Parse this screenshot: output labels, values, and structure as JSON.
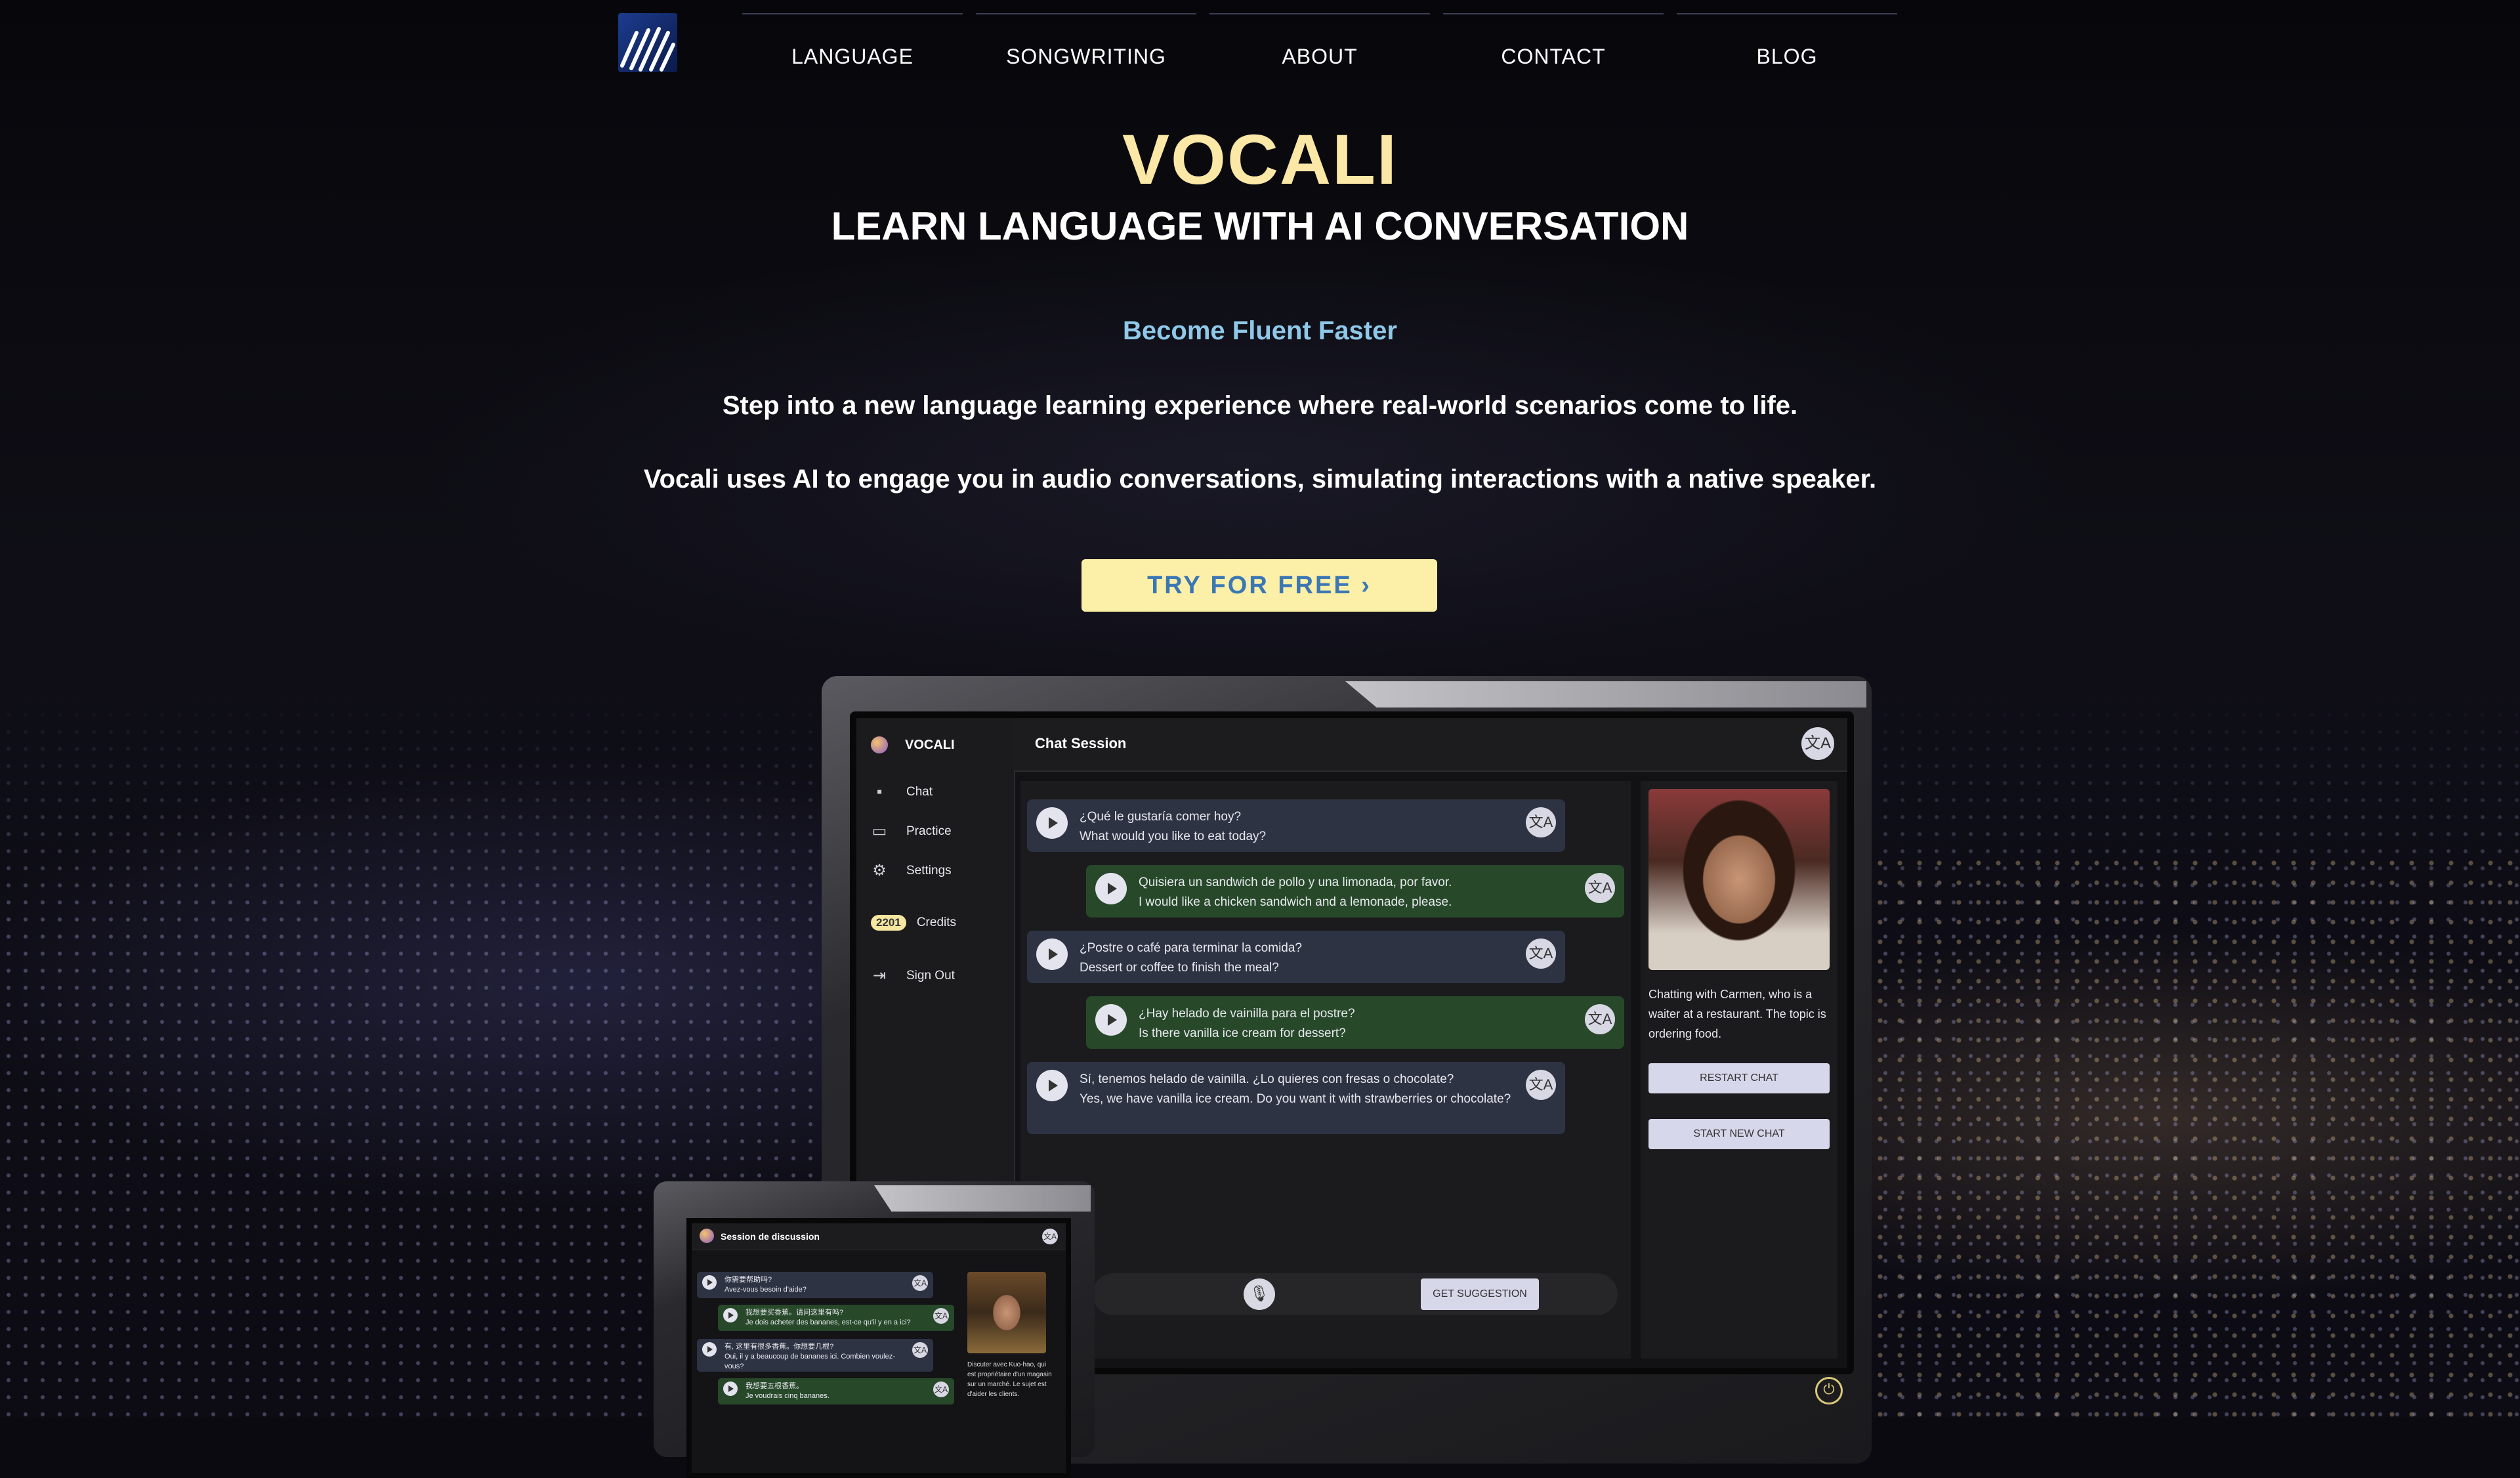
{
  "nav": {
    "items": [
      "LANGUAGE",
      "SONGWRITING",
      "ABOUT",
      "CONTACT",
      "BLOG"
    ]
  },
  "hero": {
    "title": "VOCALI",
    "subtitle": "LEARN LANGUAGE WITH AI CONVERSATION",
    "tagline": "Become Fluent Faster",
    "paragraph1": "Step into a new language learning experience where real-world scenarios come to life.",
    "paragraph2": "Vocali uses AI to engage you in audio conversations, simulating interactions with a native speaker.",
    "cta": "TRY FOR FREE ›"
  },
  "app": {
    "brand": "VOCALI",
    "sidebar": {
      "chat": "Chat",
      "practice": "Practice",
      "settings": "Settings",
      "credits_count": "2201",
      "credits": "Credits",
      "sign_out": "Sign Out"
    },
    "header_title": "Chat Session",
    "messages": [
      {
        "role": "ai",
        "text": "¿Qué le gustaría comer hoy?",
        "translation": "What would you like to eat today?"
      },
      {
        "role": "user",
        "text": "Quisiera un sandwich de pollo y una limonada, por favor.",
        "translation": "I would like a chicken sandwich and a lemonade, please."
      },
      {
        "role": "ai",
        "text": "¿Postre o café para terminar la comida?",
        "translation": "Dessert or coffee to finish the meal?"
      },
      {
        "role": "user",
        "text": "¿Hay helado de vainilla para el postre?",
        "translation": "Is there vanilla ice cream for dessert?"
      },
      {
        "role": "ai",
        "text": "Sí, tenemos helado de vainilla. ¿Lo quieres con fresas o chocolate?",
        "translation": "Yes, we have vanilla ice cream. Do you want it with strawberries or chocolate?"
      }
    ],
    "suggestion_button": "GET SUGGESTION",
    "panel_text": "Chatting with Carmen, who is a waiter at a restaurant. The topic is ordering food.",
    "restart_button": "RESTART CHAT",
    "new_chat_button": "START NEW CHAT"
  },
  "tablet": {
    "header_title": "Session de discussion",
    "messages": [
      {
        "role": "ai",
        "text": "你需要帮助吗?",
        "translation": "Avez-vous besoin d'aide?"
      },
      {
        "role": "user",
        "text": "我想要买香蕉。请问这里有吗?",
        "translation": "Je dois acheter des bananes, est-ce qu'il y en a ici?"
      },
      {
        "role": "ai",
        "text": "有, 这里有很多香蕉。你想要几根?",
        "translation": "Oui, il y a beaucoup de bananes ici. Combien voulez-vous?"
      },
      {
        "role": "user",
        "text": "我想要五根香蕉。",
        "translation": "Je voudrais cinq bananes."
      }
    ],
    "panel_text": "Discuter avec Kuo-hao, qui est propriétaire d'un magasin sur un marché. Le sujet est d'aider les clients."
  },
  "icons": {
    "translate": "文A",
    "chevron": "›"
  },
  "colors": {
    "title": "#fbe8a6",
    "tagline": "#8fc8e8",
    "cta_bg": "#fcefa8",
    "cta_text": "#3b77b4"
  }
}
